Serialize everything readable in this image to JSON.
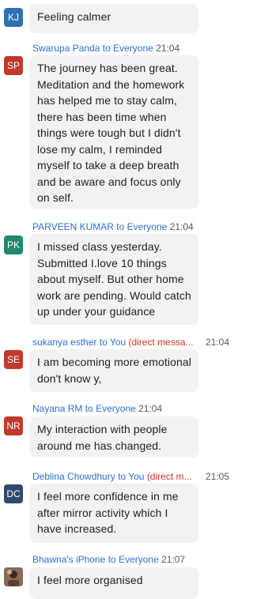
{
  "messages": [
    {
      "avatar": "KJ",
      "avatar_color": "#2f6fb2",
      "sender": "",
      "to_label": "",
      "recipient": "",
      "time": "",
      "text": "Feeling calmer"
    },
    {
      "avatar": "SP",
      "avatar_color": "#c0392b",
      "sender": "Swarupa Panda",
      "to_label": "to",
      "recipient": "Everyone",
      "time": "21:04",
      "text": "The journey has been great. Meditation and the homework has helped me to stay calm, there has been time when things were tough but I didn't lose my calm, I reminded myself to take a deep breath and be aware and focus only on self."
    },
    {
      "avatar": "PK",
      "avatar_color": "#1f8a70",
      "sender": "PARVEEN KUMAR",
      "to_label": "to",
      "recipient": "Everyone",
      "time": "21:04",
      "text": "I missed class yesterday. Submitted I.love 10 things about myself. But other home work are pending. Would catch up under your guidance"
    },
    {
      "avatar": "SE",
      "avatar_color": "#c0392b",
      "sender": "sukanya esther",
      "to_label": "to",
      "recipient": "You",
      "direct": "(direct messa...",
      "time": "21:04",
      "text": "I am becoming more emotional don't know y,"
    },
    {
      "avatar": "NR",
      "avatar_color": "#c0392b",
      "sender": "Nayana RM",
      "to_label": "to",
      "recipient": "Everyone",
      "time": "21:04",
      "text": "My interaction with people around me has changed."
    },
    {
      "avatar": "DC",
      "avatar_color": "#2f4a6a",
      "sender": "Deblina Chowdhury",
      "to_label": "to",
      "recipient": "You",
      "direct": "(direct m...",
      "time": "21:05",
      "text": "I feel more confidence in me after mirror activity which I have increased."
    },
    {
      "avatar": "",
      "avatar_color": "#6b4a3a",
      "sender": "Bhawna's iPhone",
      "to_label": "to",
      "recipient": "Everyone",
      "time": "21:07",
      "text": "I feel more organised"
    }
  ]
}
